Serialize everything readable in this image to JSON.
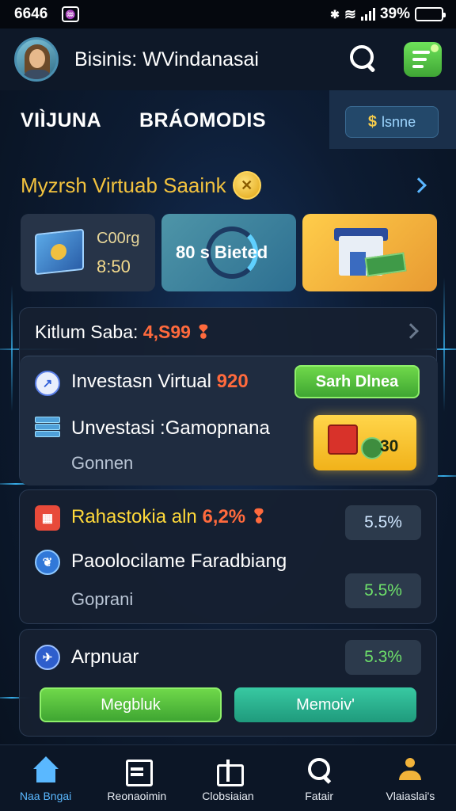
{
  "status_bar": {
    "time": "6646",
    "battery": "39%"
  },
  "header": {
    "title": "Bisinis: WVindanasai"
  },
  "tabs": {
    "tab1": "VIÌJUNA",
    "tab2": "BRÁOMODIS",
    "pill": "lsnne"
  },
  "section": {
    "title": "Myzrsh Virtuab Saaink"
  },
  "cards": [
    {
      "line1": "C00rg",
      "line2": "8:50"
    },
    {
      "label": "80 s Bieted"
    },
    {}
  ],
  "panel1": {
    "title": "Kitlum Saba:",
    "title_value": "4,S99",
    "row1": {
      "label": "Investasn Virtual",
      "value": "920",
      "button": "Sarh Dlnea"
    },
    "row2": {
      "label": "Unvestasi :Gamopnana",
      "sub": "Gonnen",
      "chip_value": "30"
    }
  },
  "panel2": {
    "row1": {
      "label": "Rahastokia aln",
      "value": "6,2%",
      "pill": "5.5%"
    },
    "row2": {
      "label": "Paoolocilame Faradbiang",
      "sub": "Goprani",
      "pill": "5.5%"
    }
  },
  "panel3": {
    "row1": {
      "label": "Arpnuar",
      "pill": "5.3%"
    },
    "button1": "Megbluk",
    "button2": "Memoiv'"
  },
  "bottom_nav": [
    {
      "label": "Naa Bngai"
    },
    {
      "label": "Reonaoimin"
    },
    {
      "label": "Clobsiaian"
    },
    {
      "label": "Fatair"
    },
    {
      "label": "Vlaiaslai's"
    }
  ],
  "colors": {
    "accent_green": "#4caf3a",
    "accent_gold": "#f2c23e",
    "accent_blue": "#5ab8ff",
    "highlight_red": "#ff6a3d"
  }
}
